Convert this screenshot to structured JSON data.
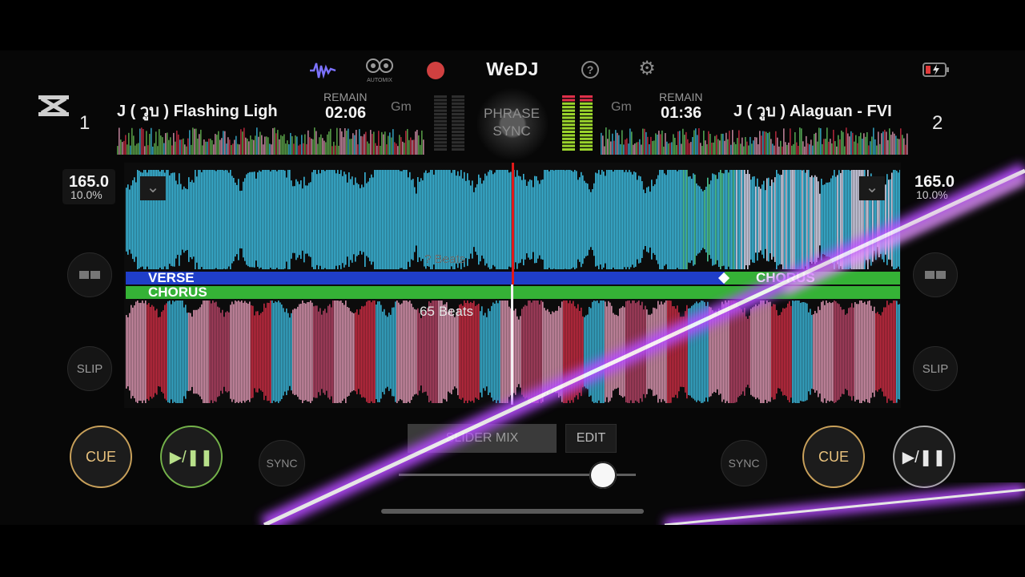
{
  "app": {
    "logo": "WeDJ",
    "automix_label": "AUTOMIX"
  },
  "topbar": {
    "icons": [
      "waveform-icon",
      "automix-icon",
      "record-icon",
      "help-icon",
      "gear-icon",
      "battery-icon"
    ]
  },
  "deck1": {
    "number": "1",
    "title": "J ( วูบ ) Flashing Ligh",
    "remain_label": "REMAIN",
    "remain": "02:06",
    "key": "Gm",
    "bpm": "165.0",
    "pitch": "10.0%"
  },
  "deck2": {
    "number": "2",
    "title": "J ( วูบ ) Alaguan - FVI",
    "remain_label": "REMAIN",
    "remain": "01:36",
    "key": "Gm",
    "bpm": "165.0",
    "pitch": "10.0%"
  },
  "phrase_sync": {
    "line1": "PHRASE",
    "line2": "SYNC"
  },
  "phrases": {
    "top_left": "VERSE",
    "top_right": "CHORUS",
    "bottom_left": "CHORUS"
  },
  "beats": {
    "top": "? Beats",
    "bottom": "65 Beats"
  },
  "controls": {
    "slip": "SLIP",
    "sync": "SYNC",
    "cue": "CUE",
    "play": "▶/❚❚",
    "mix_tab": "SLIDER MIX",
    "edit_tab": "EDIT"
  },
  "crossfader": {
    "position": 0.86
  },
  "colors": {
    "wave_blue": "#3fc8ee",
    "wave_red": "#e0304a",
    "wave_pink": "#f3a6c4",
    "phrase_blue": "#1f3ec9",
    "phrase_green": "#35b236",
    "playhead": "#e01919",
    "cue_gold": "#c8a05a",
    "play_green": "#74b24a",
    "accent_purple": "#b64bff"
  }
}
